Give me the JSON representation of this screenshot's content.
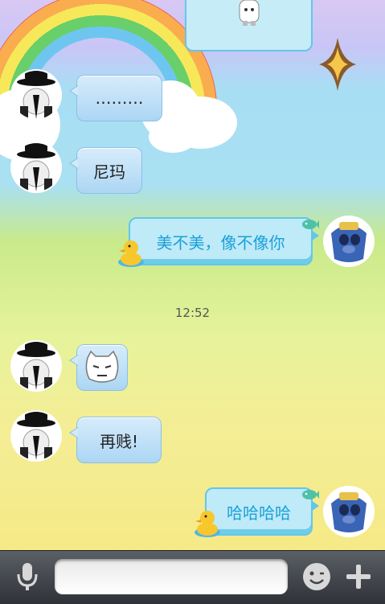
{
  "timestamp": "12:52",
  "messages": [
    {
      "side": "left",
      "text": "………"
    },
    {
      "side": "left",
      "text": "尼玛"
    },
    {
      "side": "right",
      "text": "美不美，像不像你"
    },
    {
      "side": "left",
      "sticker": "grumpy-face-sticker"
    },
    {
      "side": "left",
      "text": "再贱!"
    },
    {
      "side": "right",
      "text": "哈哈哈哈"
    }
  ],
  "toolbar": {
    "voice_icon": "microphone-icon",
    "input_placeholder": "",
    "emoji_icon": "smiley-icon",
    "more_icon": "plus-icon"
  },
  "colors": {
    "bubble_left": "#acd6f4",
    "bubble_right": "#bfeaf8",
    "bubble_right_text": "#1aa0d9",
    "toolbar": "#3a3d42"
  }
}
